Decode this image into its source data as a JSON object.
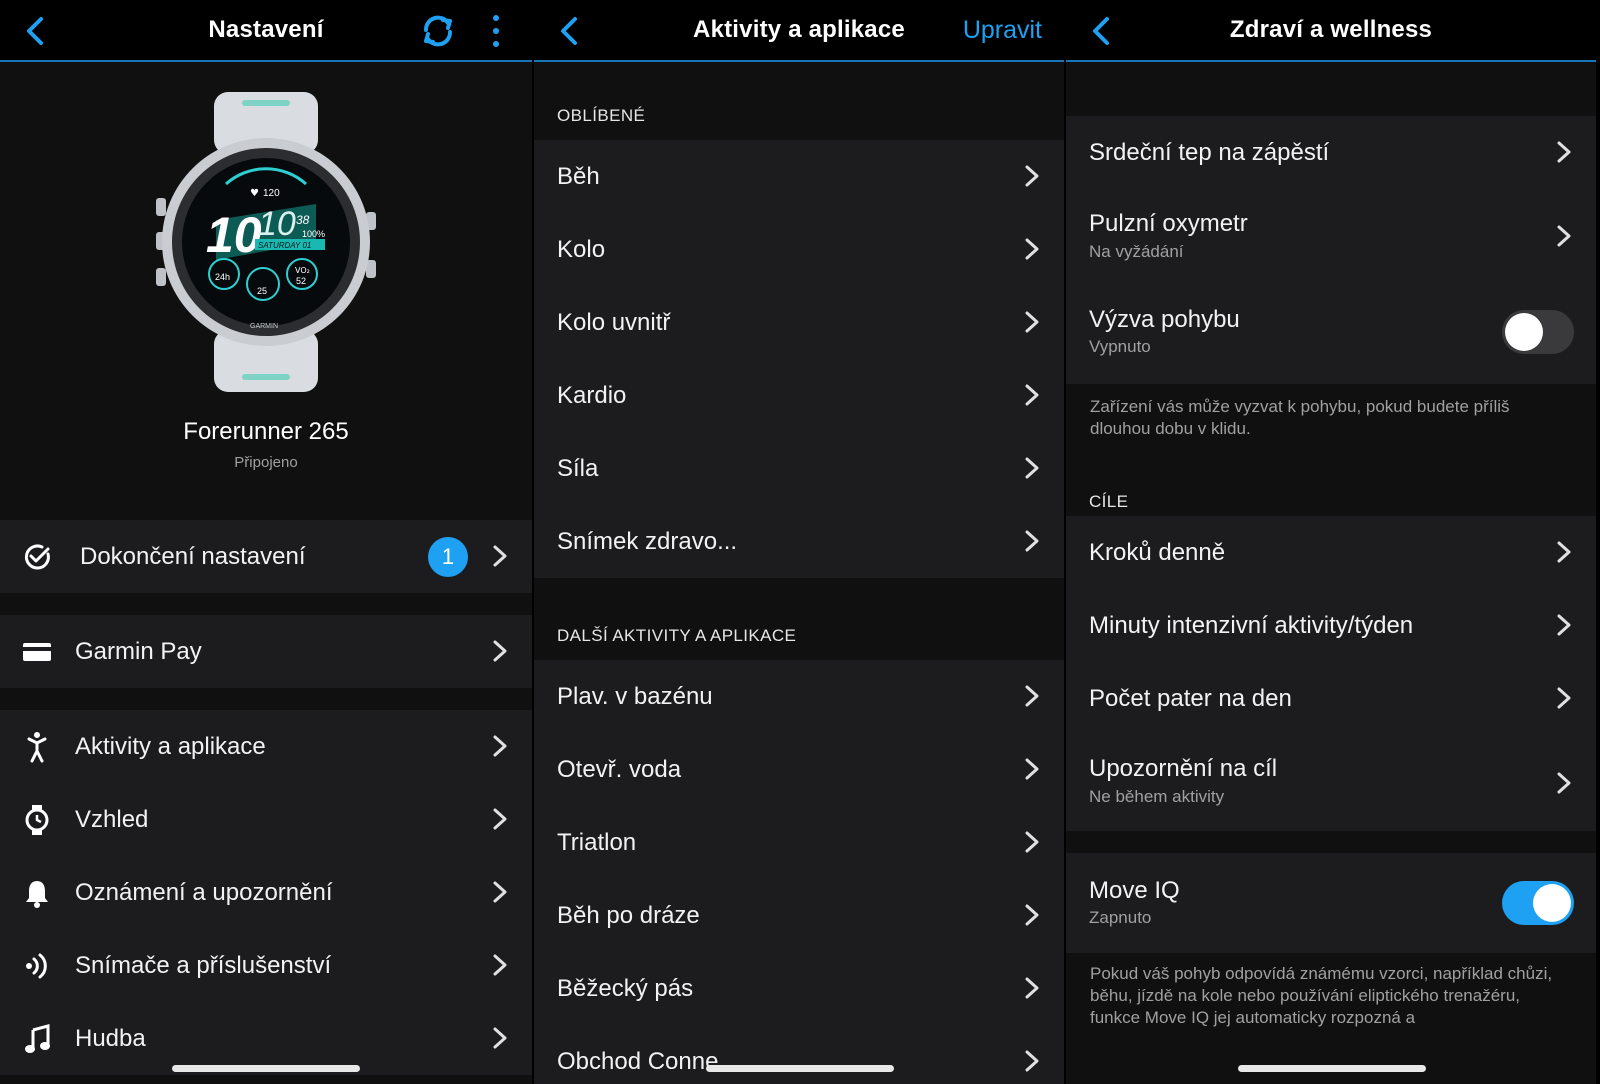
{
  "screen1": {
    "title": "Nastavení",
    "device": {
      "name": "Forerunner 265",
      "status": "Připojeno"
    },
    "watch_face": {
      "heart": "120",
      "hour": "10",
      "minute": "10",
      "seconds": "38",
      "battery": "100%",
      "date": "SATURDAY 01",
      "comp_left": "24h",
      "comp_center": "25",
      "comp_right_top": "VO₂",
      "comp_right": "52",
      "brand": "GARMIN"
    },
    "setup_item": {
      "label": "Dokončení nastavení",
      "badge": "1"
    },
    "pay_item": {
      "label": "Garmin Pay"
    },
    "items": [
      {
        "label": "Aktivity a aplikace",
        "icon": "running-person-icon"
      },
      {
        "label": "Vzhled",
        "icon": "watch-icon"
      },
      {
        "label": "Oznámení a upozornění",
        "icon": "bell-icon"
      },
      {
        "label": "Snímače a příslušenství",
        "icon": "sensor-icon"
      },
      {
        "label": "Hudba",
        "icon": "music-note-icon"
      }
    ]
  },
  "screen2": {
    "title": "Aktivity a aplikace",
    "edit_label": "Upravit",
    "favorites_header": "OBLÍBENÉ",
    "favorites": [
      "Běh",
      "Kolo",
      "Kolo uvnitř",
      "Kardio",
      "Síla",
      "Snímek zdravo..."
    ],
    "more_header": "DALŠÍ AKTIVITY A APLIKACE",
    "more": [
      "Plav. v bazénu",
      "Otevř. voda",
      "Triatlon",
      "Běh po dráze",
      "Běžecký pás",
      "Obchod Conne"
    ]
  },
  "screen3": {
    "title": "Zdraví a wellness",
    "items_top": [
      {
        "label": "Srdeční tep na zápěstí",
        "sub": ""
      },
      {
        "label": "Pulzní oxymetr",
        "sub": "Na vyžádání"
      }
    ],
    "move_alert": {
      "label": "Výzva pohybu",
      "sub": "Vypnuto",
      "on": false
    },
    "move_alert_note": "Zařízení vás může vyzvat k pohybu, pokud budete příliš dlouhou dobu v klidu.",
    "goals_header": "CÍLE",
    "goals": [
      {
        "label": "Kroků denně",
        "sub": ""
      },
      {
        "label": "Minuty intenzivní aktivity/týden",
        "sub": ""
      },
      {
        "label": "Počet pater na den",
        "sub": ""
      },
      {
        "label": "Upozornění na cíl",
        "sub": "Ne během aktivity"
      }
    ],
    "move_iq": {
      "label": "Move IQ",
      "sub": "Zapnuto",
      "on": true
    },
    "move_iq_note": "Pokud váš pohyb odpovídá známému vzorci, například chůzi, běhu, jízdě na kole nebo používání eliptického trenažéru, funkce Move IQ jej automaticky rozpozná a"
  },
  "colors": {
    "accent": "#1ea1f2",
    "row_bg": "#1c1c1e",
    "page_bg": "#101010"
  }
}
